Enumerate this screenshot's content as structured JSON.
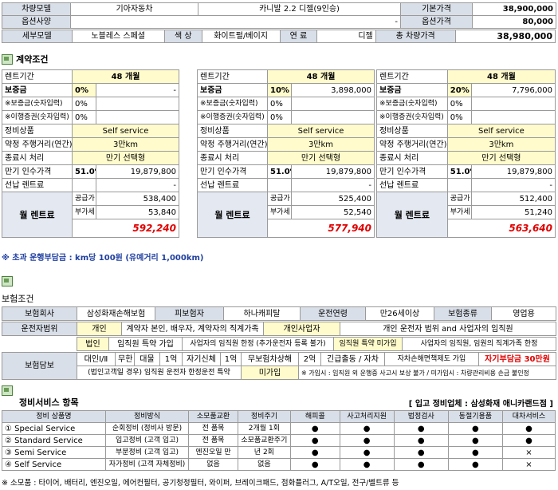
{
  "vehicle": {
    "model_label": "차량모델",
    "maker": "기아자동차",
    "model_name": "카니발 2.2 디젤(9인승)",
    "base_price_label": "기본가격",
    "base_price": "38,900,000",
    "option_label": "옵션사양",
    "option_value": "-",
    "option_price_label": "옵션가격",
    "option_price": "80,000",
    "trim_label": "세부모델",
    "trim": "노블레스 스페셜",
    "color_label": "색 상",
    "color": "화이트펄/베이지",
    "fuel_label": "연 료",
    "fuel": "디젤",
    "total_label": "총 차량가격",
    "total": "38,980,000"
  },
  "contract": {
    "title": "계약조건",
    "row_labels": {
      "period": "렌트기간",
      "deposit": "보증금",
      "deposit_sub": "※보증금(숫자입력)",
      "transfer_sub": "※이행증권(숫자입력)",
      "service": "정비상품",
      "mileage": "약정 주행거리(연간)",
      "end": "종료시 처리",
      "residual": "만기 인수가격",
      "prepay": "선납 렌트료",
      "supply": "공급가",
      "vat": "부가세",
      "monthly": "월 렌트료"
    },
    "options": [
      {
        "period": "48 개월",
        "deposit_pct": "0%",
        "deposit_amt": "-",
        "deposit_sub": "0%",
        "transfer_sub": "0%",
        "service": "Self service",
        "mileage": "3만km",
        "end": "만기 선택형",
        "residual_pct": "51.0%",
        "residual_amt": "19,879,800",
        "prepay": "-",
        "supply": "538,400",
        "vat": "53,840",
        "total": "592,240"
      },
      {
        "period": "48 개월",
        "deposit_pct": "10%",
        "deposit_amt": "3,898,000",
        "deposit_sub": "0%",
        "transfer_sub": "0%",
        "service": "Self service",
        "mileage": "3만km",
        "end": "만기 선택형",
        "residual_pct": "51.0%",
        "residual_amt": "19,879,800",
        "prepay": "-",
        "supply": "525,400",
        "vat": "52,540",
        "total": "577,940"
      },
      {
        "period": "48 개월",
        "deposit_pct": "20%",
        "deposit_amt": "7,796,000",
        "deposit_sub": "0%",
        "transfer_sub": "0%",
        "service": "Self service",
        "mileage": "3만km",
        "end": "만기 선택형",
        "residual_pct": "51.0%",
        "residual_amt": "19,879,800",
        "prepay": "-",
        "supply": "512,400",
        "vat": "51,240",
        "total": "563,640"
      }
    ],
    "note": "※ 초과 운행부담금 : km당 100원 (유예거리 1,000km)"
  },
  "insurance": {
    "title": "보험조건",
    "company_label": "보험회사",
    "company": "삼성화재손해보험",
    "insured_label": "피보험자",
    "insured": "하나캐피탈",
    "age_label": "운전연령",
    "age": "만26세이상",
    "type_label": "보험종류",
    "type": "영업용",
    "driver_label": "운전자범위",
    "d1_a": "개인",
    "d1_b": "계약자 본인, 배우자, 계약자의 직계가족",
    "d1_c": "개인사업자",
    "d1_d": "개인 운전자 범위 and 사업자의 임직원",
    "d2_a": "법인",
    "d2_b": "임직원 특약 가입",
    "d2_c": "사업자의 임직원 한정 (추가운전자 등록 불가)",
    "d2_d": "임직원 특약 미가입",
    "d2_e": "사업자의 임직원, 임원의 직계가족 한정",
    "coverage_label": "보험담보",
    "c1": "대인Ⅰ/Ⅱ",
    "c2": "무한",
    "c3": "대물",
    "c4": "1억",
    "c5": "자기신체",
    "c6": "1억",
    "c7": "무보험차상해",
    "c8": "2억",
    "c9": "긴급출동 / 자차",
    "c10": "자차손해면책제도 가입",
    "c11": "자기부담금 30만원",
    "c12": "(법인고객일 경우) 임직원 운전자 한정운전 특약",
    "c13": "미가입",
    "c14": "※ 가입시 : 임직원 외 운행중 사고시 보상 불가 / 미가입시 : 차량관리비용 손금 불인정"
  },
  "service_items": {
    "title": "정비서비스 항목",
    "provider": "[ 입고 정비업체 : 삼성화재 애니카랜드점 ]",
    "headers": [
      "정비 상품명",
      "정비방식",
      "소모품교환",
      "정비주기",
      "해피콜",
      "사고처리지원",
      "법정검사",
      "동절기용품",
      "대차서비스"
    ],
    "rows": [
      {
        "no": "①",
        "name": "Special Service",
        "method": "순회정비 (정비사 방문)",
        "parts": "전 품목",
        "cycle": "2개월 1회",
        "marks": [
          "●",
          "●",
          "●",
          "●",
          "●"
        ]
      },
      {
        "no": "②",
        "name": "Standard Service",
        "method": "입고정비 (고객 입고)",
        "parts": "전 품목",
        "cycle": "소모품교환주기",
        "marks": [
          "●",
          "●",
          "●",
          "●",
          "●"
        ]
      },
      {
        "no": "③",
        "name": "Semi Service",
        "method": "부분정비 (고객 입고)",
        "parts": "엔진오일 만",
        "cycle": "년 2회",
        "marks": [
          "●",
          "●",
          "●",
          "●",
          "×"
        ]
      },
      {
        "no": "④",
        "name": "Self Service",
        "method": "자가정비 (고객 자체정비)",
        "parts": "없음",
        "cycle": "없음",
        "marks": [
          "●",
          "●",
          "●",
          "●",
          "×"
        ]
      }
    ],
    "footnote": "※ 소모품 : 타이어, 배터리, 엔진오일, 에어컨필터, 공기청정필터, 와이퍼, 브레이크패드, 점화플러그, A/T오일, 전구/벨트류 등"
  }
}
